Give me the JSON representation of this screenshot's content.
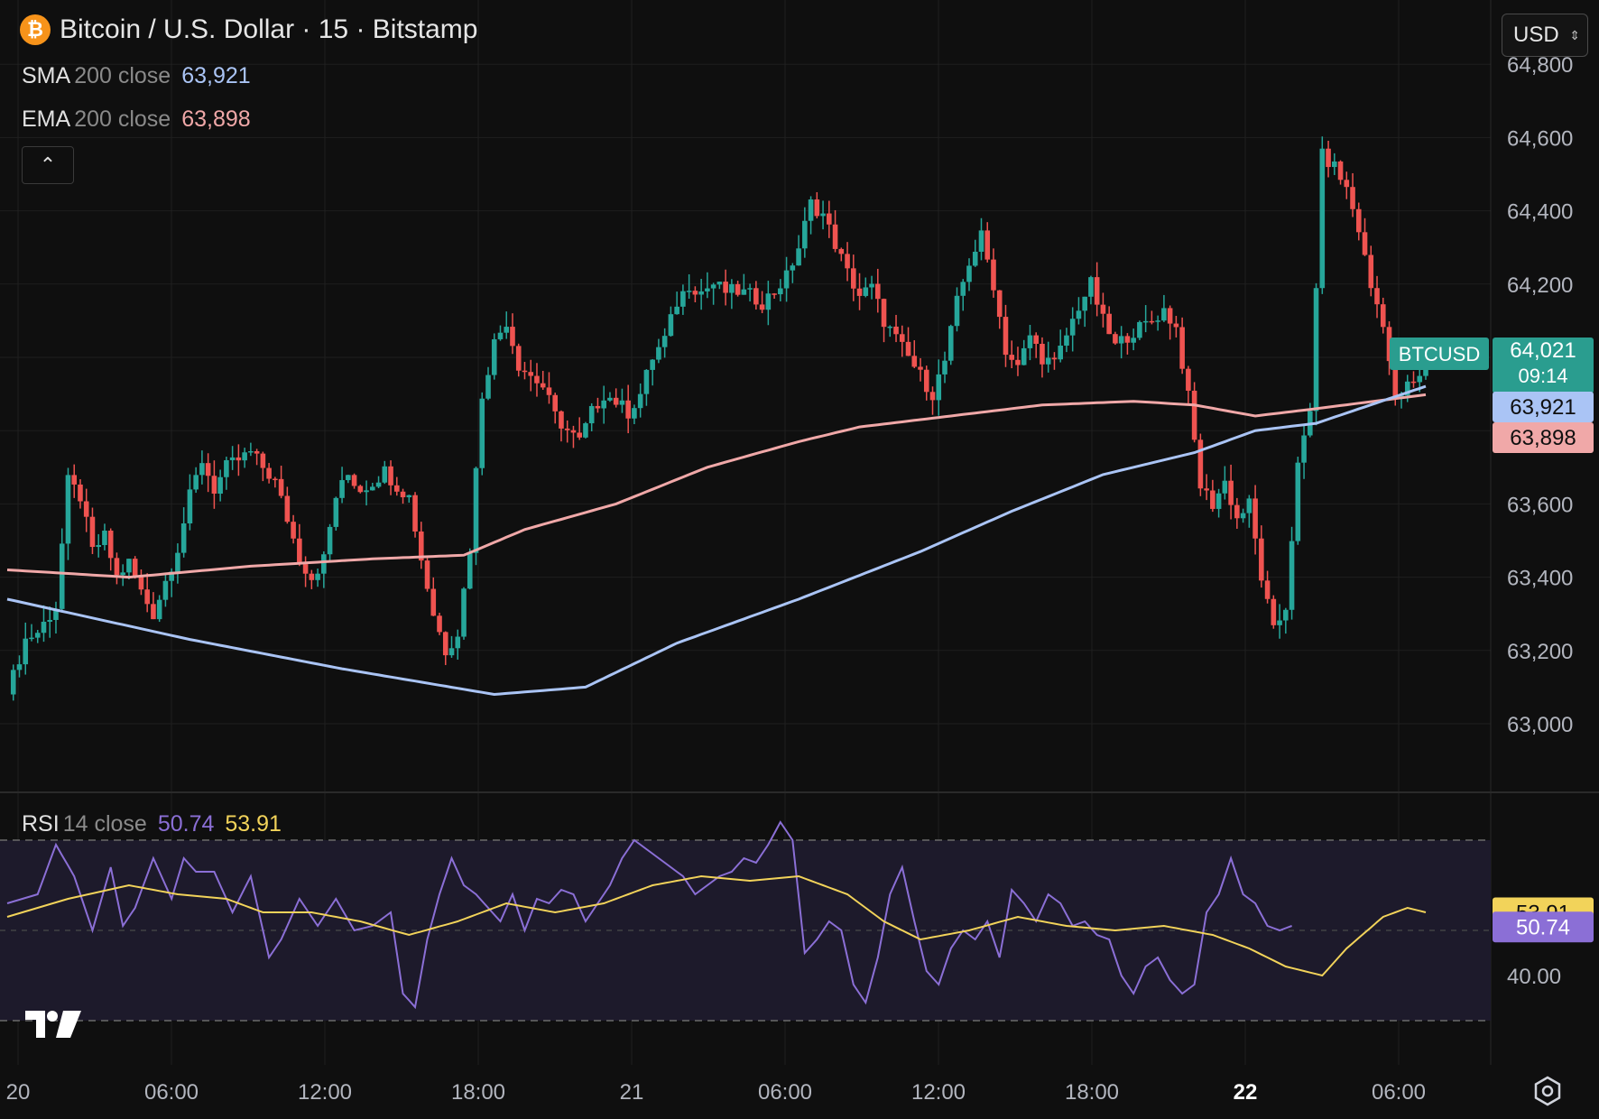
{
  "header": {
    "title": "Bitcoin / U.S. Dollar · 15 · Bitstamp",
    "icon": "bitcoin-icon",
    "currency": "USD"
  },
  "indicators": {
    "sma": {
      "name": "SMA",
      "params": "200 close",
      "value": "63,921",
      "color": "#aac4f5"
    },
    "ema": {
      "name": "EMA",
      "params": "200 close",
      "value": "63,898",
      "color": "#f0a8a8"
    },
    "rsi": {
      "name": "RSI",
      "params": "14 close",
      "value": "50.74",
      "ma_value": "53.91",
      "color": "#8b6fd6",
      "ma_color": "#f2d35a"
    }
  },
  "price_labels": {
    "symbol": "BTCUSD",
    "last": "64,021",
    "countdown": "09:14",
    "sma": "63,921",
    "ema": "63,898"
  },
  "colors": {
    "up": "#26a69a",
    "down": "#ef5350",
    "sma": "#aac4f5",
    "ema": "#f0a8a8",
    "rsi": "#8b6fd6",
    "rsi_ma": "#f2d35a"
  },
  "chart_data": {
    "type": "candlestick",
    "price_axis": {
      "ticks": [
        63000,
        63200,
        63400,
        63600,
        63800,
        64000,
        64200,
        64400,
        64600,
        64800
      ],
      "tick_labels": [
        "63,000",
        "63,200",
        "63,400",
        "63,600",
        "63,800",
        "64,000",
        "64,200",
        "64,400",
        "64,600",
        "64,800"
      ],
      "range": [
        62800,
        64850
      ]
    },
    "time_axis": {
      "labels": [
        "20",
        "06:00",
        "12:00",
        "18:00",
        "21",
        "06:00",
        "12:00",
        "18:00",
        "22",
        "06:00"
      ],
      "bold_labels": [
        "22"
      ]
    },
    "close_path": [
      [
        0,
        63080
      ],
      [
        3,
        63230
      ],
      [
        5,
        63250
      ],
      [
        8,
        63320
      ],
      [
        10,
        63660
      ],
      [
        12,
        63620
      ],
      [
        14,
        63470
      ],
      [
        16,
        63510
      ],
      [
        18,
        63400
      ],
      [
        20,
        63440
      ],
      [
        22,
        63360
      ],
      [
        24,
        63300
      ],
      [
        26,
        63390
      ],
      [
        28,
        63480
      ],
      [
        30,
        63620
      ],
      [
        32,
        63720
      ],
      [
        34,
        63640
      ],
      [
        36,
        63700
      ],
      [
        38,
        63720
      ],
      [
        40,
        63740
      ],
      [
        42,
        63700
      ],
      [
        44,
        63660
      ],
      [
        46,
        63560
      ],
      [
        48,
        63450
      ],
      [
        50,
        63400
      ],
      [
        52,
        63450
      ],
      [
        54,
        63620
      ],
      [
        56,
        63680
      ],
      [
        58,
        63640
      ],
      [
        60,
        63660
      ],
      [
        62,
        63690
      ],
      [
        64,
        63650
      ],
      [
        66,
        63620
      ],
      [
        68,
        63450
      ],
      [
        70,
        63300
      ],
      [
        72,
        63200
      ],
      [
        74,
        63250
      ],
      [
        76,
        63480
      ],
      [
        78,
        63900
      ],
      [
        80,
        64040
      ],
      [
        82,
        64100
      ],
      [
        84,
        63980
      ],
      [
        86,
        63950
      ],
      [
        88,
        63920
      ],
      [
        90,
        63840
      ],
      [
        92,
        63800
      ],
      [
        94,
        63770
      ],
      [
        96,
        63850
      ],
      [
        98,
        63900
      ],
      [
        100,
        63880
      ],
      [
        102,
        63850
      ],
      [
        104,
        63900
      ],
      [
        106,
        64000
      ],
      [
        108,
        64050
      ],
      [
        110,
        64150
      ],
      [
        112,
        64200
      ],
      [
        114,
        64180
      ],
      [
        116,
        64200
      ],
      [
        118,
        64180
      ],
      [
        120,
        64180
      ],
      [
        122,
        64170
      ],
      [
        124,
        64150
      ],
      [
        126,
        64180
      ],
      [
        128,
        64220
      ],
      [
        130,
        64300
      ],
      [
        132,
        64420
      ],
      [
        134,
        64390
      ],
      [
        136,
        64310
      ],
      [
        138,
        64230
      ],
      [
        140,
        64170
      ],
      [
        142,
        64190
      ],
      [
        144,
        64100
      ],
      [
        146,
        64050
      ],
      [
        148,
        64000
      ],
      [
        150,
        63950
      ],
      [
        152,
        63900
      ],
      [
        154,
        63990
      ],
      [
        156,
        64150
      ],
      [
        158,
        64260
      ],
      [
        160,
        64330
      ],
      [
        162,
        64200
      ],
      [
        164,
        64020
      ],
      [
        166,
        63970
      ],
      [
        168,
        64060
      ],
      [
        170,
        64000
      ],
      [
        172,
        63980
      ],
      [
        174,
        64060
      ],
      [
        176,
        64140
      ],
      [
        178,
        64200
      ],
      [
        180,
        64100
      ],
      [
        182,
        64030
      ],
      [
        184,
        64060
      ],
      [
        186,
        64080
      ],
      [
        188,
        64100
      ],
      [
        190,
        64130
      ],
      [
        192,
        64080
      ],
      [
        194,
        63890
      ],
      [
        196,
        63650
      ],
      [
        198,
        63600
      ],
      [
        200,
        63660
      ],
      [
        202,
        63560
      ],
      [
        204,
        63600
      ],
      [
        206,
        63400
      ],
      [
        208,
        63250
      ],
      [
        210,
        63320
      ],
      [
        212,
        63700
      ],
      [
        214,
        63850
      ],
      [
        215,
        64200
      ],
      [
        216,
        64550
      ],
      [
        218,
        64520
      ],
      [
        220,
        64460
      ],
      [
        222,
        64350
      ],
      [
        224,
        64190
      ],
      [
        226,
        64100
      ],
      [
        228,
        63880
      ],
      [
        230,
        63920
      ],
      [
        232,
        63940
      ],
      [
        233,
        64021
      ]
    ],
    "sma_200": [
      [
        0,
        63340
      ],
      [
        30,
        63230
      ],
      [
        55,
        63150
      ],
      [
        80,
        63080
      ],
      [
        95,
        63100
      ],
      [
        110,
        63220
      ],
      [
        130,
        63340
      ],
      [
        150,
        63470
      ],
      [
        165,
        63580
      ],
      [
        180,
        63680
      ],
      [
        195,
        63740
      ],
      [
        205,
        63800
      ],
      [
        215,
        63820
      ],
      [
        233,
        63921
      ]
    ],
    "ema_200": [
      [
        0,
        63420
      ],
      [
        20,
        63400
      ],
      [
        40,
        63430
      ],
      [
        60,
        63450
      ],
      [
        75,
        63460
      ],
      [
        85,
        63530
      ],
      [
        100,
        63600
      ],
      [
        115,
        63700
      ],
      [
        130,
        63770
      ],
      [
        140,
        63810
      ],
      [
        155,
        63840
      ],
      [
        170,
        63870
      ],
      [
        185,
        63880
      ],
      [
        195,
        63870
      ],
      [
        205,
        63840
      ],
      [
        215,
        63860
      ],
      [
        233,
        63898
      ]
    ],
    "rsi": {
      "levels": [
        70,
        30
      ],
      "tick_labels": [
        "40.00"
      ],
      "value": 50.74,
      "ma_value": 53.91,
      "rsi_values": [
        [
          0,
          56
        ],
        [
          5,
          58
        ],
        [
          8,
          69
        ],
        [
          11,
          62
        ],
        [
          14,
          50
        ],
        [
          17,
          64
        ],
        [
          19,
          51
        ],
        [
          21,
          55
        ],
        [
          24,
          66
        ],
        [
          27,
          57
        ],
        [
          29,
          66
        ],
        [
          31,
          63
        ],
        [
          34,
          63
        ],
        [
          37,
          54
        ],
        [
          40,
          62
        ],
        [
          43,
          44
        ],
        [
          45,
          48
        ],
        [
          48,
          57
        ],
        [
          51,
          51
        ],
        [
          54,
          57
        ],
        [
          57,
          50
        ],
        [
          60,
          51
        ],
        [
          63,
          54
        ],
        [
          65,
          36
        ],
        [
          67,
          33
        ],
        [
          69,
          48
        ],
        [
          71,
          58
        ],
        [
          73,
          66
        ],
        [
          75,
          60
        ],
        [
          77,
          58
        ],
        [
          79,
          55
        ],
        [
          81,
          52
        ],
        [
          83,
          58
        ],
        [
          85,
          50
        ],
        [
          87,
          57
        ],
        [
          89,
          56
        ],
        [
          91,
          59
        ],
        [
          93,
          58
        ],
        [
          95,
          52
        ],
        [
          97,
          56
        ],
        [
          99,
          60
        ],
        [
          101,
          66
        ],
        [
          103,
          70
        ],
        [
          105,
          68
        ],
        [
          107,
          66
        ],
        [
          109,
          64
        ],
        [
          111,
          62
        ],
        [
          113,
          58
        ],
        [
          115,
          60
        ],
        [
          117,
          62
        ],
        [
          119,
          63
        ],
        [
          121,
          66
        ],
        [
          123,
          65
        ],
        [
          125,
          69
        ],
        [
          127,
          74
        ],
        [
          129,
          70
        ],
        [
          131,
          45
        ],
        [
          133,
          48
        ],
        [
          135,
          52
        ],
        [
          137,
          50
        ],
        [
          139,
          38
        ],
        [
          141,
          34
        ],
        [
          143,
          44
        ],
        [
          145,
          58
        ],
        [
          147,
          64
        ],
        [
          149,
          52
        ],
        [
          151,
          41
        ],
        [
          153,
          38
        ],
        [
          155,
          46
        ],
        [
          157,
          50
        ],
        [
          159,
          48
        ],
        [
          161,
          52
        ],
        [
          163,
          44
        ],
        [
          165,
          59
        ],
        [
          167,
          56
        ],
        [
          169,
          52
        ],
        [
          171,
          58
        ],
        [
          173,
          56
        ],
        [
          175,
          51
        ],
        [
          177,
          52
        ],
        [
          179,
          49
        ],
        [
          181,
          48
        ],
        [
          183,
          40
        ],
        [
          185,
          36
        ],
        [
          187,
          42
        ],
        [
          189,
          44
        ],
        [
          191,
          39
        ],
        [
          193,
          36
        ],
        [
          195,
          38
        ],
        [
          197,
          54
        ],
        [
          199,
          58
        ],
        [
          201,
          66
        ],
        [
          203,
          58
        ],
        [
          205,
          56
        ],
        [
          207,
          51
        ],
        [
          209,
          50
        ],
        [
          211,
          51
        ]
      ],
      "ma_values": [
        [
          0,
          53
        ],
        [
          10,
          57
        ],
        [
          20,
          60
        ],
        [
          28,
          58
        ],
        [
          36,
          57
        ],
        [
          42,
          54
        ],
        [
          50,
          54
        ],
        [
          58,
          52
        ],
        [
          66,
          49
        ],
        [
          74,
          52
        ],
        [
          82,
          56
        ],
        [
          90,
          54
        ],
        [
          98,
          56
        ],
        [
          106,
          60
        ],
        [
          114,
          62
        ],
        [
          122,
          61
        ],
        [
          130,
          62
        ],
        [
          138,
          58
        ],
        [
          144,
          52
        ],
        [
          150,
          48
        ],
        [
          158,
          50
        ],
        [
          166,
          53
        ],
        [
          174,
          51
        ],
        [
          182,
          50
        ],
        [
          190,
          51
        ],
        [
          198,
          49
        ],
        [
          204,
          46
        ],
        [
          210,
          42
        ],
        [
          216,
          40
        ],
        [
          220,
          46
        ],
        [
          226,
          53
        ],
        [
          230,
          55
        ],
        [
          233,
          54
        ]
      ]
    }
  }
}
